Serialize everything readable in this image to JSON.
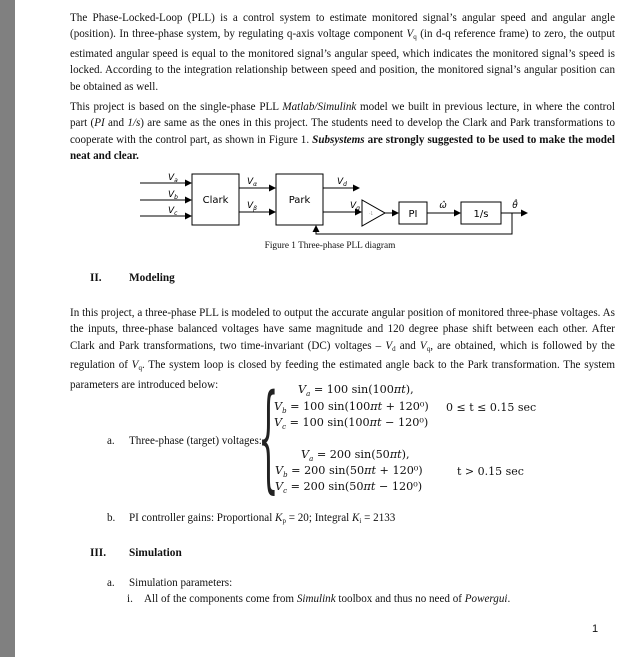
{
  "intro": {
    "p1": {
      "a": "The Phase-Locked-Loop (PLL) is a control system to estimate monitored signal’s angular speed and angular angle (position). In three-phase system, by regulating q-axis voltage component ",
      "sym": "V",
      "sub": "q",
      "b": " (in d-q reference frame) to zero, the output estimated angular speed is equal to the monitored signal’s angular speed, which indicates the monitored signal’s speed is locked. According to the integration relationship between speed and position, the monitored signal’s angular position can be obtained as well."
    },
    "p2": {
      "a": "This project is based on the single-phase PLL ",
      "i1": "Matlab/Simulink",
      "b": " model we built in previous lecture, in where the control part (",
      "i2": "PI",
      "c": " and ",
      "i3": "1/s",
      "d": ") are same as the ones in this project. The students need to develop the Clark and Park transformations to cooperate with the control part, as shown in Figure 1. ",
      "bi": "Subsystems",
      "bold": " are strongly suggested to be used to make the model neat and clear."
    }
  },
  "figure": {
    "caption": "Figure 1 Three-phase PLL diagram",
    "inputs": [
      {
        "sym": "V",
        "sub": "a"
      },
      {
        "sym": "V",
        "sub": "b"
      },
      {
        "sym": "V",
        "sub": "c"
      }
    ],
    "clark_label": "Clark",
    "park_label": "Park",
    "alpha_label": {
      "sym": "V",
      "sub": "α"
    },
    "beta_label": {
      "sym": "V",
      "sub": "β"
    },
    "d_label": {
      "sym": "V",
      "sub": "d"
    },
    "q_label": {
      "sym": "V",
      "sub": "q"
    },
    "gain_label": "-1",
    "pi_label": "PI",
    "omega_label": "ω̂",
    "integrator_label": "1/s",
    "theta_label": "θ̂"
  },
  "section2": {
    "number": "II.",
    "title": "Modeling",
    "para": {
      "a": "In this project, a three-phase PLL is modeled to output the accurate angular position of monitored three-phase voltages. As the inputs, three-phase balanced voltages have same magnitude and 120 degree phase shift between each other. After Clark and Park transformations, two time-invariant (DC) voltages – ",
      "vd": "V",
      "vd_sub": "d",
      "b": " and ",
      "vq": "V",
      "vq_sub": "q",
      "c": ", are obtained, which is followed by the regulation of ",
      "vq2": "V",
      "vq2_sub": "q",
      "d": ". The system loop is closed by feeding the estimated angle back to the Park transformation. The system parameters are introduced below:"
    },
    "items": [
      {
        "marker": "a.",
        "label": "Three-phase (target) voltages:",
        "group1": {
          "eqs": [
            "V_a = 100 sin(100πt),",
            "V_b = 100 sin(100πt + 120⁰)",
            "V_c = 100 sin(100πt − 120⁰)"
          ],
          "condition": "0 ≤ t  ≤ 0.15 sec"
        },
        "group2": {
          "eqs": [
            "V_a = 200 sin(50πt),",
            "V_b = 200 sin(50πt + 120⁰)",
            "V_c = 200 sin(50πt − 120⁰)"
          ],
          "condition": "t  > 0.15 sec"
        }
      },
      {
        "marker": "b.",
        "text_a": "PI controller gains: Proportional ",
        "kp_sym": "K",
        "kp_sub": "p",
        "text_b": " = 20; Integral ",
        "ki_sym": "K",
        "ki_sub": "i",
        "text_c": " = 2133"
      }
    ]
  },
  "section3": {
    "number": "III.",
    "title": "Simulation",
    "item_a": {
      "marker": "a.",
      "text": "Simulation parameters:"
    },
    "item_i": {
      "marker": "i.",
      "a": "All of the components come from ",
      "i1": "Simulink",
      "b": " toolbox and thus no need of ",
      "i2": "Powergui",
      "c": "."
    }
  },
  "page_number": "1",
  "eq_parts": {
    "g1": [
      {
        "v": "V",
        "s": "a",
        "rhs": " = 100 sin(100",
        "pi": "πt",
        "tail": "),"
      },
      {
        "v": "V",
        "s": "b",
        "rhs": " = 100 sin(100",
        "pi": "πt",
        "tail": " + 120⁰)"
      },
      {
        "v": "V",
        "s": "c",
        "rhs": " = 100 sin(100",
        "pi": "πt",
        "tail": " − 120⁰)"
      }
    ],
    "g2": [
      {
        "v": "V",
        "s": "a",
        "rhs": " = 200 sin(50",
        "pi": "πt",
        "tail": "),"
      },
      {
        "v": "V",
        "s": "b",
        "rhs": " = 200 sin(50",
        "pi": "πt",
        "tail": " + 120⁰)"
      },
      {
        "v": "V",
        "s": "c",
        "rhs": " = 200 sin(50",
        "pi": "πt",
        "tail": " − 120⁰)"
      }
    ]
  }
}
